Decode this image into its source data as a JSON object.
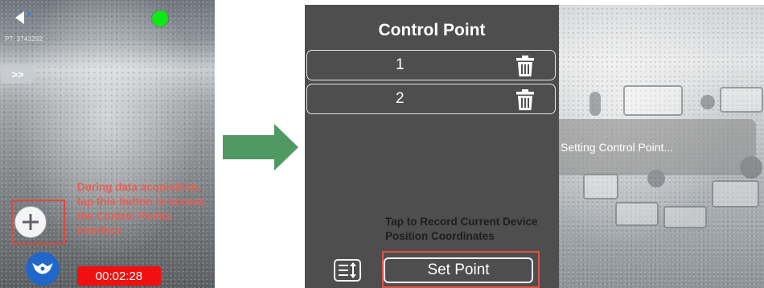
{
  "left_screen": {
    "point_count": "PT: 3743292",
    "expand_label": ">>",
    "annotation": "During data acquisition, tap this button to access the Control Points interface",
    "timer": "00:02:28",
    "icons": {
      "back": "back-arrow-icon",
      "gps": "gps-status-dot",
      "add": "plus-icon",
      "logo": "app-logo-icon"
    },
    "colors": {
      "gps_ok": "#0ee814",
      "timer_bg": "#f01010",
      "annotation": "#e56055",
      "highlight": "#d94a40"
    }
  },
  "arrow": {
    "color": "#4f9a63",
    "icon": "right-arrow-icon"
  },
  "control_point_panel": {
    "title": "Control Point",
    "points": [
      {
        "label": "1"
      },
      {
        "label": "2"
      }
    ],
    "record_hint": "Tap to Record Current Device Position Coordinates",
    "set_point_label": "Set Point",
    "icons": {
      "delete": "trash-icon",
      "list": "list-sort-icon"
    }
  },
  "right_screen": {
    "toast": "Setting Control Point..."
  }
}
